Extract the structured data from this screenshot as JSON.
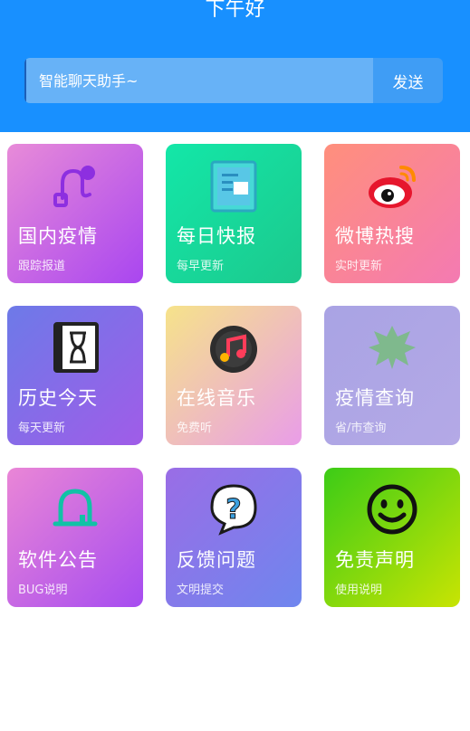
{
  "header": {
    "greeting": "下午好"
  },
  "chat": {
    "placeholder": "智能聊天助手~",
    "send_label": "发送"
  },
  "cards": [
    {
      "title": "国内疫情",
      "subtitle": "跟踪报道",
      "icon": "route-icon"
    },
    {
      "title": "每日快报",
      "subtitle": "每早更新",
      "icon": "notepad-icon"
    },
    {
      "title": "微博热搜",
      "subtitle": "实时更新",
      "icon": "weibo-icon"
    },
    {
      "title": "历史今天",
      "subtitle": "每天更新",
      "icon": "hourglass-icon"
    },
    {
      "title": "在线音乐",
      "subtitle": "免费听",
      "icon": "music-disc-icon"
    },
    {
      "title": "疫情查询",
      "subtitle": "省/市查询",
      "icon": "leaf-icon"
    },
    {
      "title": "软件公告",
      "subtitle": "BUG说明",
      "icon": "bell-icon"
    },
    {
      "title": "反馈问题",
      "subtitle": "文明提交",
      "icon": "question-bubble-icon"
    },
    {
      "title": "免责声明",
      "subtitle": "使用说明",
      "icon": "smiley-icon"
    }
  ],
  "colors": {
    "header": "#1890ff",
    "card_gradients": [
      [
        "#e88bd8",
        "#a946f0"
      ],
      [
        "#13e7a8",
        "#1cc98d"
      ],
      [
        "#ff8f7c",
        "#f47ab2"
      ],
      [
        "#6d7ae8",
        "#a05ce8"
      ],
      [
        "#f6e38a",
        "#e99de8"
      ],
      [
        "#a9a3e4",
        "#b4a9e6"
      ],
      [
        "#ea86d6",
        "#a64cf0"
      ],
      [
        "#9a6de6",
        "#6f86ee"
      ],
      [
        "#3ccc17",
        "#c8e403"
      ]
    ]
  }
}
